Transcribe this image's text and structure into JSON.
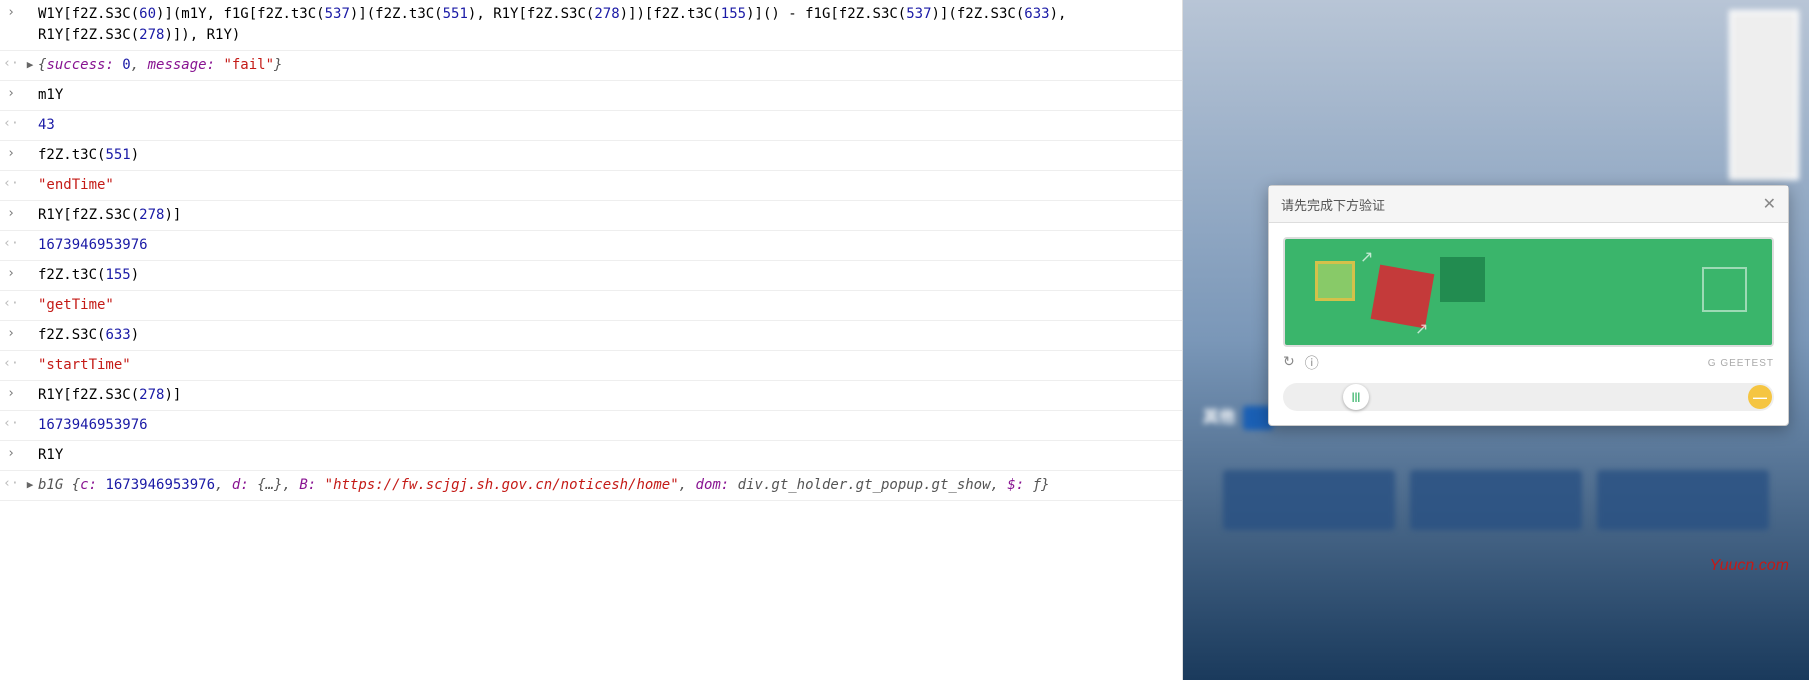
{
  "console": {
    "entries": [
      {
        "type": "in",
        "expand": false,
        "tokens": [
          {
            "t": "W1Y[f2Z.S3C("
          },
          {
            "t": "60",
            "c": "num"
          },
          {
            "t": ")](m1Y, f1G[f2Z.t3C("
          },
          {
            "t": "537",
            "c": "num"
          },
          {
            "t": ")](f2Z.t3C("
          },
          {
            "t": "551",
            "c": "num"
          },
          {
            "t": "), R1Y[f2Z.S3C("
          },
          {
            "t": "278",
            "c": "num"
          },
          {
            "t": ")])[f2Z.t3C("
          },
          {
            "t": "155",
            "c": "num"
          },
          {
            "t": ")]() - f1G[f2Z.S3C("
          },
          {
            "t": "537",
            "c": "num"
          },
          {
            "t": ")](f2Z.S3C("
          },
          {
            "t": "633",
            "c": "num"
          },
          {
            "t": "), R1Y[f2Z.S3C("
          },
          {
            "t": "278",
            "c": "num"
          },
          {
            "t": ")]), R1Y)"
          }
        ]
      },
      {
        "type": "out",
        "expand": true,
        "tokens": [
          {
            "t": "{",
            "c": "obj"
          },
          {
            "t": "success: ",
            "c": "key"
          },
          {
            "t": "0",
            "c": "num"
          },
          {
            "t": ", ",
            "c": "obj"
          },
          {
            "t": "message: ",
            "c": "key"
          },
          {
            "t": "\"fail\"",
            "c": "str"
          },
          {
            "t": "}",
            "c": "obj"
          }
        ]
      },
      {
        "type": "in",
        "expand": false,
        "tokens": [
          {
            "t": "m1Y"
          }
        ]
      },
      {
        "type": "out",
        "expand": false,
        "tokens": [
          {
            "t": "43",
            "c": "num"
          }
        ]
      },
      {
        "type": "in",
        "expand": false,
        "tokens": [
          {
            "t": "f2Z.t3C("
          },
          {
            "t": "551",
            "c": "num"
          },
          {
            "t": ")"
          }
        ]
      },
      {
        "type": "out",
        "expand": false,
        "tokens": [
          {
            "t": "\"endTime\"",
            "c": "str"
          }
        ]
      },
      {
        "type": "in",
        "expand": false,
        "tokens": [
          {
            "t": "R1Y[f2Z.S3C("
          },
          {
            "t": "278",
            "c": "num"
          },
          {
            "t": ")]"
          }
        ]
      },
      {
        "type": "out",
        "expand": false,
        "tokens": [
          {
            "t": "1673946953976",
            "c": "num"
          }
        ]
      },
      {
        "type": "in",
        "expand": false,
        "tokens": [
          {
            "t": "f2Z.t3C("
          },
          {
            "t": "155",
            "c": "num"
          },
          {
            "t": ")"
          }
        ]
      },
      {
        "type": "out",
        "expand": false,
        "tokens": [
          {
            "t": "\"getTime\"",
            "c": "str"
          }
        ]
      },
      {
        "type": "in",
        "expand": false,
        "tokens": [
          {
            "t": "f2Z.S3C("
          },
          {
            "t": "633",
            "c": "num"
          },
          {
            "t": ")"
          }
        ]
      },
      {
        "type": "out",
        "expand": false,
        "tokens": [
          {
            "t": "\"startTime\"",
            "c": "str"
          }
        ]
      },
      {
        "type": "in",
        "expand": false,
        "tokens": [
          {
            "t": "R1Y[f2Z.S3C("
          },
          {
            "t": "278",
            "c": "num"
          },
          {
            "t": ")]"
          }
        ]
      },
      {
        "type": "out",
        "expand": false,
        "tokens": [
          {
            "t": "1673946953976",
            "c": "num"
          }
        ]
      },
      {
        "type": "in",
        "expand": false,
        "tokens": [
          {
            "t": "R1Y"
          }
        ]
      },
      {
        "type": "out",
        "expand": true,
        "tokens": [
          {
            "t": "b1G {",
            "c": "obj"
          },
          {
            "t": "c: ",
            "c": "key"
          },
          {
            "t": "1673946953976",
            "c": "num"
          },
          {
            "t": ", ",
            "c": "obj"
          },
          {
            "t": "d: ",
            "c": "key"
          },
          {
            "t": "{…}",
            "c": "obj"
          },
          {
            "t": ", ",
            "c": "obj"
          },
          {
            "t": "B: ",
            "c": "key"
          },
          {
            "t": "\"https://fw.scjgj.sh.gov.cn/noticesh/home\"",
            "c": "url"
          },
          {
            "t": ", ",
            "c": "obj"
          },
          {
            "t": "dom: ",
            "c": "key"
          },
          {
            "t": "div.gt_holder.gt_popup.gt_show",
            "c": "obj"
          },
          {
            "t": ", ",
            "c": "obj"
          },
          {
            "t": "$: ",
            "c": "key"
          },
          {
            "t": "ƒ",
            "c": "obj"
          },
          {
            "t": "}",
            "c": "obj"
          }
        ]
      }
    ],
    "arrow_in": "›",
    "arrow_out": "‹·",
    "expand_icon": "▶"
  },
  "side": {
    "nav_label": "其他",
    "watermark": "Yuucn.com"
  },
  "captcha": {
    "title": "请先完成下方验证",
    "brand": "GEETEST",
    "refresh_icon": "↻",
    "info_icon": "ⓘ",
    "brand_icon": "G",
    "slider_handle": "|||",
    "slider_end": "—"
  }
}
